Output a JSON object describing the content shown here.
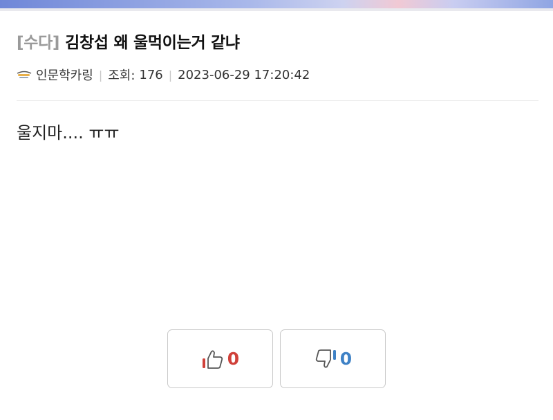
{
  "colors": {
    "upvote": "#d0413a",
    "downvote": "#3f82c6",
    "category": "#9a9a9a"
  },
  "post": {
    "category": "[수다]",
    "title": "김창섭 왜 울먹이는거 같냐",
    "author": "인문학카링",
    "author_icon": "user-level-icon",
    "views_label": "조회:",
    "views": "176",
    "datetime": "2023-06-29 17:20:42",
    "body": "울지마....  ㅠㅠ"
  },
  "votes": {
    "up_icon": "thumbs-up-icon",
    "up_count": "0",
    "down_icon": "thumbs-down-icon",
    "down_count": "0"
  }
}
